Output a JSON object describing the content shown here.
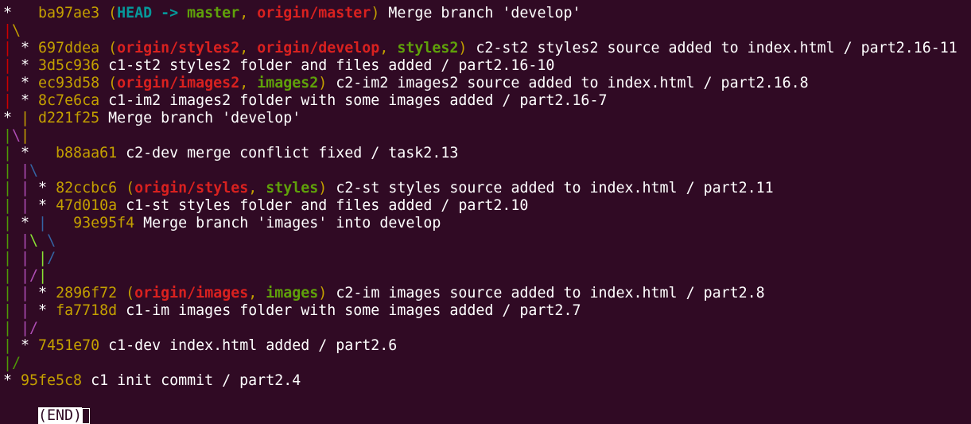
{
  "terminal": {
    "lines": [
      [
        {
          "t": "*   ",
          "c": "c-white"
        },
        {
          "t": "ba97ae3",
          "c": "c-yellow"
        },
        {
          "t": " (",
          "c": "c-yellow"
        },
        {
          "t": "HEAD -> ",
          "c": "c-cyan-b"
        },
        {
          "t": "master",
          "c": "c-green-b"
        },
        {
          "t": ", ",
          "c": "c-yellow"
        },
        {
          "t": "origin/master",
          "c": "c-red-b"
        },
        {
          "t": ")",
          "c": "c-yellow"
        },
        {
          "t": " Merge branch 'develop'",
          "c": "c-white"
        }
      ],
      [
        {
          "t": "|",
          "c": "c-red"
        },
        {
          "t": "\\",
          "c": "c-yellow"
        }
      ],
      [
        {
          "t": "|",
          "c": "c-red"
        },
        {
          "t": " * ",
          "c": "c-white"
        },
        {
          "t": "697ddea",
          "c": "c-yellow"
        },
        {
          "t": " (",
          "c": "c-yellow"
        },
        {
          "t": "origin/styles2",
          "c": "c-red-b"
        },
        {
          "t": ", ",
          "c": "c-yellow"
        },
        {
          "t": "origin/develop",
          "c": "c-red-b"
        },
        {
          "t": ", ",
          "c": "c-yellow"
        },
        {
          "t": "styles2",
          "c": "c-green-b"
        },
        {
          "t": ")",
          "c": "c-yellow"
        },
        {
          "t": " c2-st2 styles2 source added to index.html / part2.16-11",
          "c": "c-white"
        }
      ],
      [
        {
          "t": "|",
          "c": "c-red"
        },
        {
          "t": " * ",
          "c": "c-white"
        },
        {
          "t": "3d5c936",
          "c": "c-yellow"
        },
        {
          "t": " c1-st2 styles2 folder and files added / part2.16-10",
          "c": "c-white"
        }
      ],
      [
        {
          "t": "|",
          "c": "c-red"
        },
        {
          "t": " * ",
          "c": "c-white"
        },
        {
          "t": "ec93d58",
          "c": "c-yellow"
        },
        {
          "t": " (",
          "c": "c-yellow"
        },
        {
          "t": "origin/images2",
          "c": "c-red-b"
        },
        {
          "t": ", ",
          "c": "c-yellow"
        },
        {
          "t": "images2",
          "c": "c-green-b"
        },
        {
          "t": ")",
          "c": "c-yellow"
        },
        {
          "t": " c2-im2 images2 source added to index.html / part2.16.8",
          "c": "c-white"
        }
      ],
      [
        {
          "t": "|",
          "c": "c-red"
        },
        {
          "t": " * ",
          "c": "c-white"
        },
        {
          "t": "8c7e6ca",
          "c": "c-yellow"
        },
        {
          "t": " c1-im2 images2 folder with some images added / part2.16-7",
          "c": "c-white"
        }
      ],
      [
        {
          "t": "* ",
          "c": "c-white"
        },
        {
          "t": "|",
          "c": "c-yellow"
        },
        {
          "t": " ",
          "c": "c-white"
        },
        {
          "t": "d221f25",
          "c": "c-yellow"
        },
        {
          "t": " Merge branch 'develop'",
          "c": "c-white"
        }
      ],
      [
        {
          "t": "|",
          "c": "c-green"
        },
        {
          "t": "\\",
          "c": "c-magenta"
        },
        {
          "t": "|",
          "c": "c-yellow"
        }
      ],
      [
        {
          "t": "|",
          "c": "c-green"
        },
        {
          "t": " *   ",
          "c": "c-white"
        },
        {
          "t": "b88aa61",
          "c": "c-yellow"
        },
        {
          "t": " c2-dev merge conflict fixed / task2.13",
          "c": "c-white"
        }
      ],
      [
        {
          "t": "|",
          "c": "c-green"
        },
        {
          "t": " ",
          "c": "c-white"
        },
        {
          "t": "|",
          "c": "c-magenta"
        },
        {
          "t": "\\",
          "c": "c-blue"
        }
      ],
      [
        {
          "t": "|",
          "c": "c-green"
        },
        {
          "t": " ",
          "c": "c-white"
        },
        {
          "t": "|",
          "c": "c-magenta"
        },
        {
          "t": " * ",
          "c": "c-white"
        },
        {
          "t": "82ccbc6",
          "c": "c-yellow"
        },
        {
          "t": " (",
          "c": "c-yellow"
        },
        {
          "t": "origin/styles",
          "c": "c-red-b"
        },
        {
          "t": ", ",
          "c": "c-yellow"
        },
        {
          "t": "styles",
          "c": "c-green-b"
        },
        {
          "t": ")",
          "c": "c-yellow"
        },
        {
          "t": " c2-st styles source added to index.html / part2.11",
          "c": "c-white"
        }
      ],
      [
        {
          "t": "|",
          "c": "c-green"
        },
        {
          "t": " ",
          "c": "c-white"
        },
        {
          "t": "|",
          "c": "c-magenta"
        },
        {
          "t": " * ",
          "c": "c-white"
        },
        {
          "t": "47d010a",
          "c": "c-yellow"
        },
        {
          "t": " c1-st styles folder and files added / part2.10",
          "c": "c-white"
        }
      ],
      [
        {
          "t": "|",
          "c": "c-green"
        },
        {
          "t": " * ",
          "c": "c-white"
        },
        {
          "t": "|",
          "c": "c-blue"
        },
        {
          "t": "   ",
          "c": "c-white"
        },
        {
          "t": "93e95f4",
          "c": "c-yellow"
        },
        {
          "t": " Merge branch 'images' into develop",
          "c": "c-white"
        }
      ],
      [
        {
          "t": "|",
          "c": "c-green"
        },
        {
          "t": " ",
          "c": "c-white"
        },
        {
          "t": "|",
          "c": "c-magenta"
        },
        {
          "t": "\\",
          "c": "c-lgreen"
        },
        {
          "t": " ",
          "c": "c-white"
        },
        {
          "t": "\\",
          "c": "c-blue"
        }
      ],
      [
        {
          "t": "|",
          "c": "c-green"
        },
        {
          "t": " ",
          "c": "c-white"
        },
        {
          "t": "|",
          "c": "c-magenta"
        },
        {
          "t": " ",
          "c": "c-white"
        },
        {
          "t": "|",
          "c": "c-lgreen"
        },
        {
          "t": "/",
          "c": "c-blue"
        }
      ],
      [
        {
          "t": "|",
          "c": "c-green"
        },
        {
          "t": " ",
          "c": "c-white"
        },
        {
          "t": "|",
          "c": "c-magenta"
        },
        {
          "t": "/",
          "c": "c-magenta"
        },
        {
          "t": "|",
          "c": "c-lgreen"
        }
      ],
      [
        {
          "t": "|",
          "c": "c-green"
        },
        {
          "t": " ",
          "c": "c-white"
        },
        {
          "t": "|",
          "c": "c-magenta"
        },
        {
          "t": " * ",
          "c": "c-white"
        },
        {
          "t": "2896f72",
          "c": "c-yellow"
        },
        {
          "t": " (",
          "c": "c-yellow"
        },
        {
          "t": "origin/images",
          "c": "c-red-b"
        },
        {
          "t": ", ",
          "c": "c-yellow"
        },
        {
          "t": "images",
          "c": "c-green-b"
        },
        {
          "t": ")",
          "c": "c-yellow"
        },
        {
          "t": " c2-im images source added to index.html / part2.8",
          "c": "c-white"
        }
      ],
      [
        {
          "t": "|",
          "c": "c-green"
        },
        {
          "t": " ",
          "c": "c-white"
        },
        {
          "t": "|",
          "c": "c-magenta"
        },
        {
          "t": " * ",
          "c": "c-white"
        },
        {
          "t": "fa7718d",
          "c": "c-yellow"
        },
        {
          "t": " c1-im images folder with some images added / part2.7",
          "c": "c-white"
        }
      ],
      [
        {
          "t": "|",
          "c": "c-green"
        },
        {
          "t": " ",
          "c": "c-white"
        },
        {
          "t": "|",
          "c": "c-magenta"
        },
        {
          "t": "/",
          "c": "c-magenta"
        }
      ],
      [
        {
          "t": "|",
          "c": "c-green"
        },
        {
          "t": " * ",
          "c": "c-white"
        },
        {
          "t": "7451e70",
          "c": "c-yellow"
        },
        {
          "t": " c1-dev index.html added / part2.6",
          "c": "c-white"
        }
      ],
      [
        {
          "t": "|",
          "c": "c-green"
        },
        {
          "t": "/",
          "c": "c-green"
        }
      ],
      [
        {
          "t": "* ",
          "c": "c-white"
        },
        {
          "t": "95fe5c8",
          "c": "c-yellow"
        },
        {
          "t": " c1 init commit / part2.4",
          "c": "c-white"
        }
      ]
    ],
    "end_label": "(END)"
  }
}
